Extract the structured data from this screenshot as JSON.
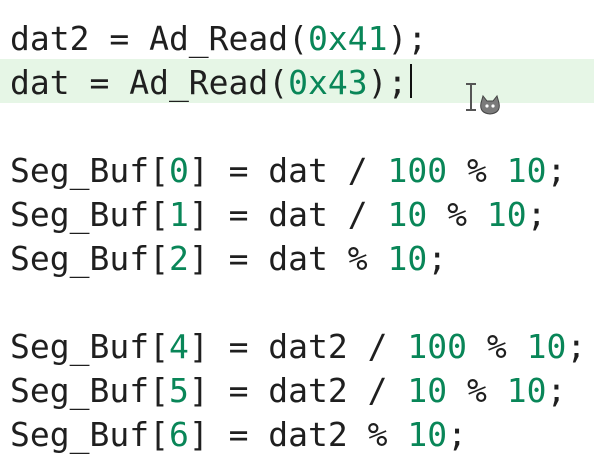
{
  "editor": {
    "lines": [
      {
        "tokens": [
          {
            "t": "dat2 = Ad_Read(",
            "k": "text"
          },
          {
            "t": "0x41",
            "k": "num"
          },
          {
            "t": ");",
            "k": "text"
          }
        ]
      },
      {
        "tokens": [
          {
            "t": "dat = Ad_Read(",
            "k": "text"
          },
          {
            "t": "0x43",
            "k": "num"
          },
          {
            "t": ");",
            "k": "text"
          }
        ],
        "current": true
      },
      {
        "tokens": []
      },
      {
        "tokens": [
          {
            "t": "Seg_Buf[",
            "k": "text"
          },
          {
            "t": "0",
            "k": "num"
          },
          {
            "t": "] = dat / ",
            "k": "text"
          },
          {
            "t": "100",
            "k": "num"
          },
          {
            "t": " % ",
            "k": "text"
          },
          {
            "t": "10",
            "k": "num"
          },
          {
            "t": ";",
            "k": "text"
          }
        ]
      },
      {
        "tokens": [
          {
            "t": "Seg_Buf[",
            "k": "text"
          },
          {
            "t": "1",
            "k": "num"
          },
          {
            "t": "] = dat / ",
            "k": "text"
          },
          {
            "t": "10",
            "k": "num"
          },
          {
            "t": " % ",
            "k": "text"
          },
          {
            "t": "10",
            "k": "num"
          },
          {
            "t": ";",
            "k": "text"
          }
        ]
      },
      {
        "tokens": [
          {
            "t": "Seg_Buf[",
            "k": "text"
          },
          {
            "t": "2",
            "k": "num"
          },
          {
            "t": "] = dat % ",
            "k": "text"
          },
          {
            "t": "10",
            "k": "num"
          },
          {
            "t": ";",
            "k": "text"
          }
        ]
      },
      {
        "tokens": []
      },
      {
        "tokens": [
          {
            "t": "Seg_Buf[",
            "k": "text"
          },
          {
            "t": "4",
            "k": "num"
          },
          {
            "t": "] = dat2 / ",
            "k": "text"
          },
          {
            "t": "100",
            "k": "num"
          },
          {
            "t": " % ",
            "k": "text"
          },
          {
            "t": "10",
            "k": "num"
          },
          {
            "t": ";",
            "k": "text"
          }
        ]
      },
      {
        "tokens": [
          {
            "t": "Seg_Buf[",
            "k": "text"
          },
          {
            "t": "5",
            "k": "num"
          },
          {
            "t": "] = dat2 / ",
            "k": "text"
          },
          {
            "t": "10",
            "k": "num"
          },
          {
            "t": " % ",
            "k": "text"
          },
          {
            "t": "10",
            "k": "num"
          },
          {
            "t": ";",
            "k": "text"
          }
        ]
      },
      {
        "tokens": [
          {
            "t": "Seg_Buf[",
            "k": "text"
          },
          {
            "t": "6",
            "k": "num"
          },
          {
            "t": "] = dat2 % ",
            "k": "text"
          },
          {
            "t": "10",
            "k": "num"
          },
          {
            "t": ";",
            "k": "text"
          }
        ]
      }
    ]
  },
  "colors": {
    "text": "#1f1f1f",
    "number": "#098658",
    "current_line_highlight": "#e6f6e6",
    "background": "#ffffff"
  },
  "icons": {
    "text_cursor": "text-caret-icon",
    "mouse_pointer": "ibeam-cursor-icon",
    "pointer_badge": "cat-badge-icon"
  }
}
